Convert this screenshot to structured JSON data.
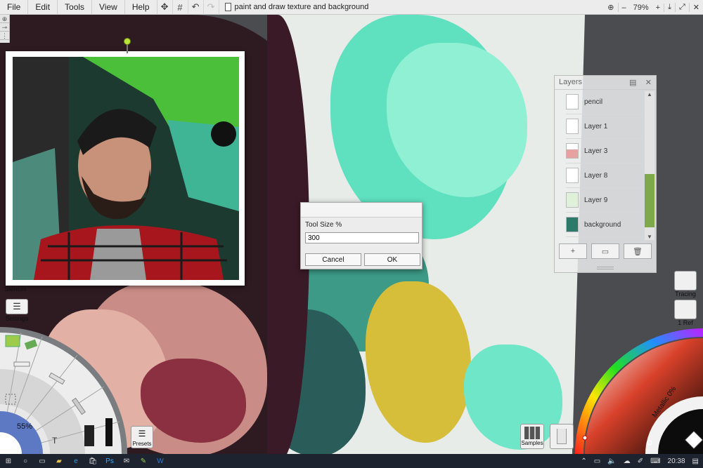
{
  "menu": {
    "items": [
      "File",
      "Edit",
      "Tools",
      "View",
      "Help"
    ]
  },
  "toolbar": {
    "icons": [
      "move-icon",
      "grid-icon",
      "undo-icon",
      "redo-icon"
    ],
    "document_title": "paint and draw texture and background",
    "zoom_minus": "–",
    "zoom_value": "79%",
    "zoom_plus": "+"
  },
  "left_panel": {
    "stencils_label": "Stencils",
    "settings_label": "Settings"
  },
  "tool_wheel": {
    "size_percent": "55%",
    "text_tool": "T"
  },
  "presets": {
    "label": "Presets"
  },
  "layers": {
    "title": "Layers",
    "items": [
      {
        "name": "pencil"
      },
      {
        "name": "Layer 1"
      },
      {
        "name": "Layer 3"
      },
      {
        "name": "Layer 8"
      },
      {
        "name": "Layer 9"
      },
      {
        "name": "background"
      }
    ],
    "add": "+",
    "folder": "▭",
    "trash": "🗑"
  },
  "dialog": {
    "label": "Tool Size %",
    "value": "300",
    "cancel": "Cancel",
    "ok": "OK"
  },
  "right_panel": {
    "tracing_label": "Tracing",
    "ref_label": "1 Ref"
  },
  "samples": {
    "label": "Samples"
  },
  "color_picker": {
    "metallic_label": "Metallic 0%"
  },
  "taskbar": {
    "time": "20:38"
  },
  "colors": {
    "accent_green": "#7fa84a",
    "teal_paint": "#5fe0bf",
    "yellow_paint": "#d7be3a",
    "dark_paint": "#3a1a26"
  }
}
